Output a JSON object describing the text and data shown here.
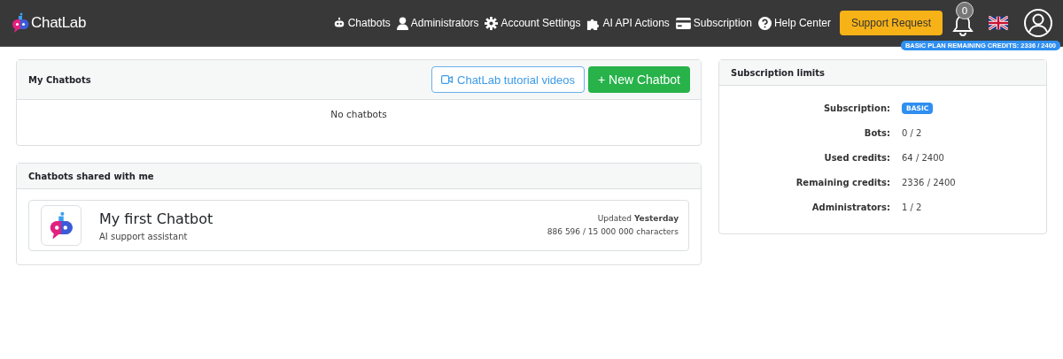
{
  "navbar": {
    "logo": "**Chat**Lab",
    "links": [
      {
        "label": "Chatbots"
      },
      {
        "label": "Administrators"
      },
      {
        "label": "Account Settings"
      },
      {
        "label": "AI API Actions"
      },
      {
        "label": "Subscription"
      },
      {
        "label": "Help Center"
      }
    ],
    "support_button": "Support Request",
    "notification_count": "0",
    "credits_badge": "BASIC PLAN REMAINING CREDITS: 2336 / 2400"
  },
  "my_chatbots": {
    "title": "My Chatbots",
    "tutorial_button": "ChatLab tutorial videos",
    "new_button": "+ New Chatbot",
    "empty_text": "No chatbots"
  },
  "shared": {
    "title": "Chatbots shared with me",
    "bots": [
      {
        "name": "My first Chatbot",
        "description": "AI support assistant",
        "updated": "Updated **Yesterday**",
        "characters": "886 596 / 15 000 000 characters"
      }
    ]
  },
  "limits": {
    "title": "Subscription limits",
    "rows": [
      {
        "label": "Subscription:",
        "value": "BASIC",
        "kind": "badge"
      },
      {
        "label": "Bots:",
        "value": "0 / 2",
        "kind": "text"
      },
      {
        "label": "Used credits:",
        "value": "64 / 2400",
        "kind": "text"
      },
      {
        "label": "Remaining credits:",
        "value": "2336 / 2400",
        "kind": "text"
      },
      {
        "label": "Administrators:",
        "value": "1 / 2",
        "kind": "text"
      }
    ]
  }
}
